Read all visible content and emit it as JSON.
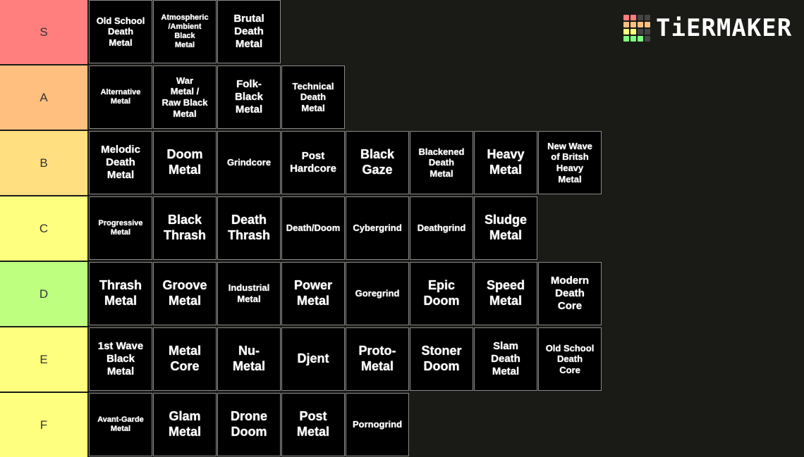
{
  "logo": {
    "text": "TiERMAKER",
    "grid_colors": [
      "#ff7f7f",
      "#ff7f7f",
      "#444",
      "#444",
      "#ffbf7f",
      "#ffbf7f",
      "#ffbf7f",
      "#ffbf7f",
      "#ffff7f",
      "#ffff7f",
      "#444",
      "#444",
      "#7fff7f",
      "#7fff7f",
      "#7fff7f",
      "#444"
    ]
  },
  "tiers": [
    {
      "label": "S",
      "color": "#ff7f7f",
      "items": [
        "Old School\nDeath\nMetal",
        "Atmospheric\n/Ambient\nBlack\nMetal",
        "Brutal\nDeath\nMetal"
      ]
    },
    {
      "label": "A",
      "color": "#ffbf7f",
      "items": [
        "Alternative\nMetal",
        "War\nMetal /\nRaw Black\nMetal",
        "Folk-\nBlack\nMetal",
        "Technical\nDeath\nMetal"
      ]
    },
    {
      "label": "B",
      "color": "#ffdf7f",
      "items": [
        "Melodic\nDeath\nMetal",
        "Doom\nMetal",
        "Grindcore",
        "Post\nHardcore",
        "Black\nGaze",
        "Blackened\nDeath\nMetal",
        "Heavy\nMetal",
        "New Wave\nof Britsh\nHeavy\nMetal"
      ]
    },
    {
      "label": "C",
      "color": "#ffff7f",
      "items": [
        "Progressive\nMetal",
        "Black\nThrash",
        "Death\nThrash",
        "Death/Doom",
        "Cybergrind",
        "Deathgrind",
        "Sludge\nMetal"
      ]
    },
    {
      "label": "D",
      "color": "#bfff7f",
      "items": [
        "Thrash\nMetal",
        "Groove\nMetal",
        "Industrial\nMetal",
        "Power\nMetal",
        "Goregrind",
        "Epic\nDoom",
        "Speed\nMetal",
        "Modern\nDeath\nCore"
      ]
    },
    {
      "label": "E",
      "color": "#ffff7f",
      "items": [
        "1st Wave\nBlack\nMetal",
        "Metal\nCore",
        "Nu-\nMetal",
        "Djent",
        "Proto-\nMetal",
        "Stoner\nDoom",
        "Slam\nDeath\nMetal",
        "Old School\nDeath\nCore"
      ]
    },
    {
      "label": "F",
      "color": "#ffff7f",
      "items": [
        "Avant-Garde\nMetal",
        "Glam\nMetal",
        "Drone\nDoom",
        "Post\nMetal",
        "Pornogrind"
      ]
    }
  ]
}
